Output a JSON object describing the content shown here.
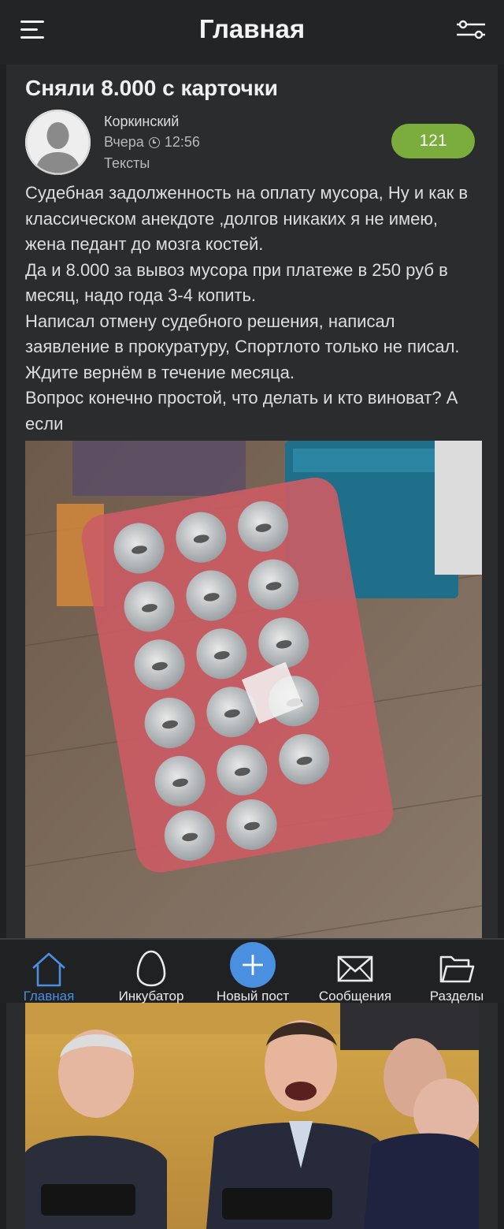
{
  "header": {
    "title": "Главная"
  },
  "post": {
    "title": "Сняли 8.000 с карточки",
    "author": "Коркинский",
    "date": "Вчера",
    "time": "12:56",
    "section": "Тексты",
    "rating": "121",
    "paragraphs": [
      "Судебная задолженность на оплату мусора, Ну и как в классическом анекдоте ,долгов никаких я не имею, жена педант до мозга костей.",
      "Да и 8.000 за вывоз мусора при платеже в 250 руб в месяц, надо года 3-4 копить.",
      "Написал отмену судебного решения, написал заявление в прокуратуру, Спортлото только не писал. Ждите вернём в течение месяца.",
      "Вопрос конечно простой, что делать и кто виноват? А если"
    ]
  },
  "nav": {
    "home": "Главная",
    "incubator": "Инкубатор",
    "new_post": "Новый пост",
    "messages": "Сообщения",
    "sections": "Разделы"
  },
  "colors": {
    "accent": "#4a8fe0",
    "rating_bg": "#7aad3b",
    "background": "#1e2022"
  }
}
